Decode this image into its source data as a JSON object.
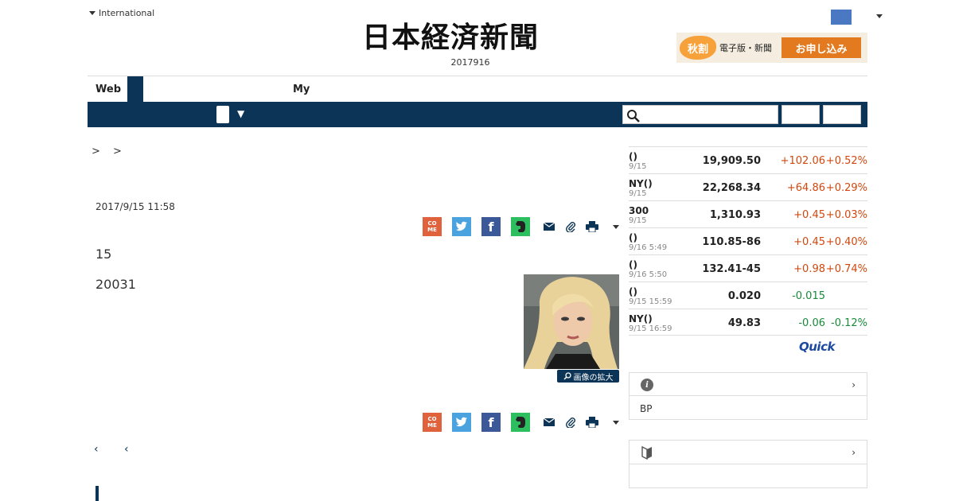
{
  "header": {
    "edition_label": "International",
    "logo_text": "日本経済新聞",
    "date_text": "2017916",
    "promo": {
      "seal": "秋割",
      "label": "電子版・新聞",
      "button": "お申し込み"
    }
  },
  "nav": {
    "tabs": [
      {
        "label": "Web"
      },
      {
        "label": "My"
      }
    ],
    "dropdown_arrow": "▼"
  },
  "search": {
    "placeholder": "",
    "icon": "search-icon"
  },
  "article": {
    "breadcrumb": "> >",
    "published": "2017/9/15 11:58",
    "paragraphs": [
      "15",
      "20031"
    ],
    "photo_zoom_label": "画像の拡大",
    "pager": "‹ ‹",
    "share_icons": [
      "come-icon",
      "twitter-icon",
      "facebook-icon",
      "evernote-icon",
      "mail-icon",
      "clip-icon",
      "print-icon"
    ]
  },
  "markets": [
    {
      "name": "()",
      "date": "9/15",
      "value": "19,909.50",
      "change": "+102.06",
      "pct": "+0.52%",
      "dir": "up"
    },
    {
      "name": "NY()",
      "date": "9/15",
      "value": "22,268.34",
      "change": "+64.86",
      "pct": "+0.29%",
      "dir": "up"
    },
    {
      "name": "300",
      "date": "9/15",
      "value": "1,310.93",
      "change": "+0.45",
      "pct": "+0.03%",
      "dir": "up"
    },
    {
      "name": "()",
      "date": "9/16 5:49",
      "value": "110.85-86",
      "change": "+0.45",
      "pct": "+0.40%",
      "dir": "up"
    },
    {
      "name": "()",
      "date": "9/16 5:50",
      "value": "132.41-45",
      "change": "+0.98",
      "pct": "+0.74%",
      "dir": "up"
    },
    {
      "name": "()",
      "date": "9/15 15:59",
      "value": "0.020",
      "change": "-0.015",
      "pct": "",
      "dir": "down"
    },
    {
      "name": "NY()",
      "date": "9/15 16:59",
      "value": "49.83",
      "change": "-0.06",
      "pct": "-0.12%",
      "dir": "down"
    }
  ],
  "quick_logo": "Quick",
  "sidebar": {
    "box1": {
      "item": "BP",
      "chevron": "›"
    },
    "box2": {
      "chevron": "›"
    }
  },
  "colors": {
    "navy": "#0b3456",
    "up": "#d0480f",
    "down": "#1a8a3a",
    "promo_orange": "#e37a1f"
  }
}
